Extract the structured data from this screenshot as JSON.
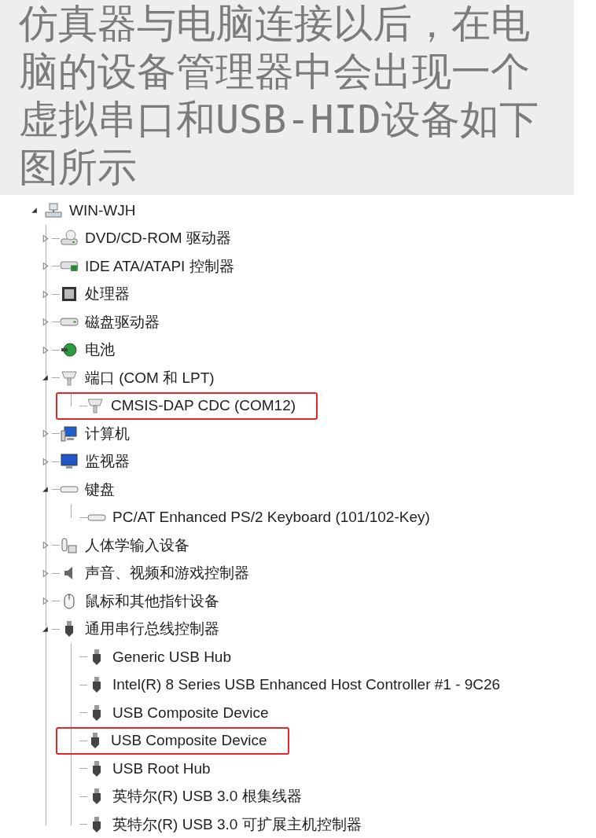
{
  "intro": {
    "text": "仿真器与电脑连接以后，在电脑的设备管理器中会出现一个虚拟串口和USB-HID设备如下图所示"
  },
  "device_tree": {
    "kind": "computer",
    "label": "WIN-WJH",
    "expanded": true,
    "children": [
      {
        "kind": "dvd",
        "label": "DVD/CD-ROM 驱动器",
        "expanded": false,
        "highlighted": false
      },
      {
        "kind": "ide",
        "label": "IDE ATA/ATAPI 控制器",
        "expanded": false,
        "highlighted": false
      },
      {
        "kind": "cpu",
        "label": "处理器",
        "expanded": false,
        "highlighted": false
      },
      {
        "kind": "disk",
        "label": "磁盘驱动器",
        "expanded": false,
        "highlighted": false
      },
      {
        "kind": "battery",
        "label": "电池",
        "expanded": false,
        "highlighted": false
      },
      {
        "kind": "port",
        "label": "端口 (COM 和 LPT)",
        "expanded": true,
        "highlighted": false,
        "children": [
          {
            "kind": "port",
            "label": "CMSIS-DAP CDC (COM12)",
            "highlighted": true
          }
        ]
      },
      {
        "kind": "pc",
        "label": "计算机",
        "expanded": false,
        "highlighted": false
      },
      {
        "kind": "monitor",
        "label": "监视器",
        "expanded": false,
        "highlighted": false
      },
      {
        "kind": "keyboard",
        "label": "键盘",
        "expanded": true,
        "highlighted": false,
        "children": [
          {
            "kind": "keyboard",
            "label": "PC/AT Enhanced PS/2 Keyboard (101/102-Key)",
            "highlighted": false
          }
        ]
      },
      {
        "kind": "hid",
        "label": "人体学输入设备",
        "expanded": false,
        "highlighted": false
      },
      {
        "kind": "sound",
        "label": "声音、视频和游戏控制器",
        "expanded": false,
        "highlighted": false
      },
      {
        "kind": "mouse",
        "label": "鼠标和其他指针设备",
        "expanded": false,
        "highlighted": false
      },
      {
        "kind": "usb",
        "label": "通用串行总线控制器",
        "expanded": true,
        "highlighted": false,
        "children": [
          {
            "kind": "usb",
            "label": "Generic USB Hub",
            "highlighted": false
          },
          {
            "kind": "usb",
            "label": "Intel(R) 8 Series USB Enhanced Host Controller #1 - 9C26",
            "highlighted": false
          },
          {
            "kind": "usb",
            "label": "USB Composite Device",
            "highlighted": false
          },
          {
            "kind": "usb",
            "label": "USB Composite Device",
            "highlighted": true
          },
          {
            "kind": "usb",
            "label": "USB Root Hub",
            "highlighted": false
          },
          {
            "kind": "usb",
            "label": "英特尔(R) USB 3.0 根集线器",
            "highlighted": false
          },
          {
            "kind": "usb",
            "label": "英特尔(R) USB 3.0 可扩展主机控制器",
            "highlighted": false
          }
        ]
      }
    ]
  }
}
